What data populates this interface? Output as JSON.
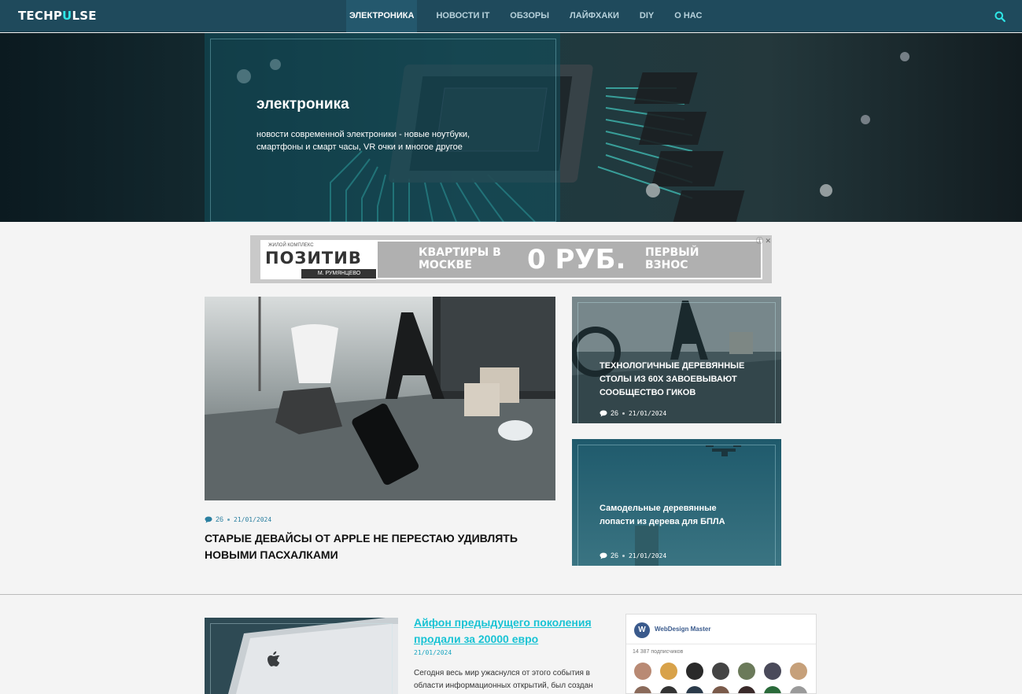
{
  "header": {
    "logo_part1": "TECHP",
    "logo_accent": "U",
    "logo_part2": "LSE",
    "nav": [
      {
        "label": "ЭЛЕКТРОНИКА",
        "active": true
      },
      {
        "label": "НОВОСТИ IT"
      },
      {
        "label": "ОБЗОРЫ"
      },
      {
        "label": "ЛАЙФХАКИ"
      },
      {
        "label": "DIY"
      },
      {
        "label": "О НАС"
      }
    ],
    "search_icon": "search-icon"
  },
  "hero": {
    "title": "электроника",
    "description": "новости современной электроники - новые ноутбуки, смартфоны и смарт часы, VR очки и многое другое"
  },
  "ad": {
    "brand_top": "ЖИЛОЙ КОМПЛЕКС",
    "brand_name": "ПОЗИТИВ",
    "brand_location": "М. РУМЯНЦЕВО",
    "text1": "КВАРТИРЫ В МОСКВЕ",
    "text2": "0 РУБ.",
    "text3": "ПЕРВЫЙ ВЗНОС",
    "close_label": "ⓘ ✕"
  },
  "featured": {
    "comments": "26",
    "date": "21/01/2024",
    "title": "Старые девайсы от Apple не перестаю удивлять новыми пасхалками"
  },
  "side_cards": [
    {
      "title": "Технологичные деревянные столы из 60х завоевывают сообщество гиков",
      "comments": "26",
      "date": "21/01/2024"
    },
    {
      "title": "Самодельные деревянные лопасти из дерева для БПЛА",
      "comments": "26",
      "date": "21/01/2024"
    }
  ],
  "article": {
    "title": "Айфон предыдущего поколения продали за 20000 евро",
    "date": "21/01/2024",
    "excerpt": "Сегодня весь мир ужаснулся от этого события в области информационных открытий, был создан"
  },
  "widget": {
    "logo_letter": "W",
    "name": "WebDesign Master",
    "subscribers": "14 387 подписчиков"
  },
  "colors": {
    "header_bg": "#1f4a5c",
    "accent": "#2ee6e6",
    "link": "#19c3d4"
  }
}
